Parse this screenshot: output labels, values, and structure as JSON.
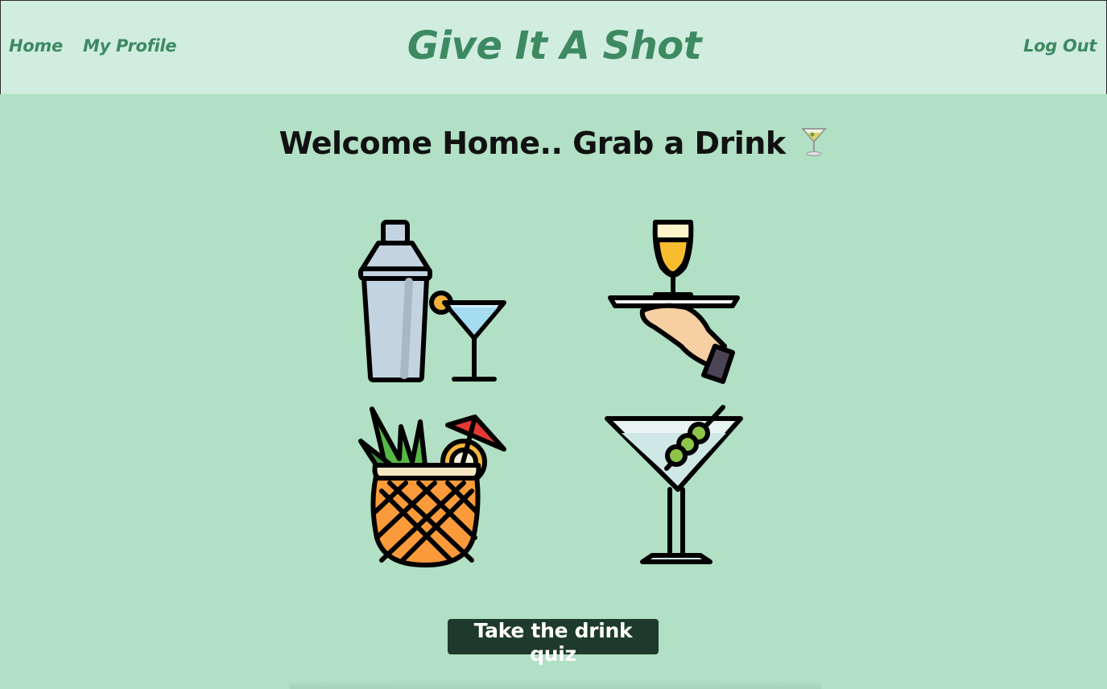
{
  "nav": {
    "home": "Home",
    "profile": "My Profile",
    "logout": "Log Out",
    "brand": "Give It A Shot"
  },
  "main": {
    "welcome": "Welcome Home.. Grab a Drink",
    "welcome_icon": "cocktail-glass-icon",
    "illustrations": [
      "shaker-and-martini-icon",
      "serving-tray-icon",
      "pineapple-cocktail-icon",
      "olive-martini-icon"
    ],
    "quiz_button": "Take the drink quiz"
  },
  "colors": {
    "background": "#b1e0c4",
    "navbar": "#d1ede0",
    "accent": "#3d8a62",
    "button": "#1e3a2c"
  }
}
